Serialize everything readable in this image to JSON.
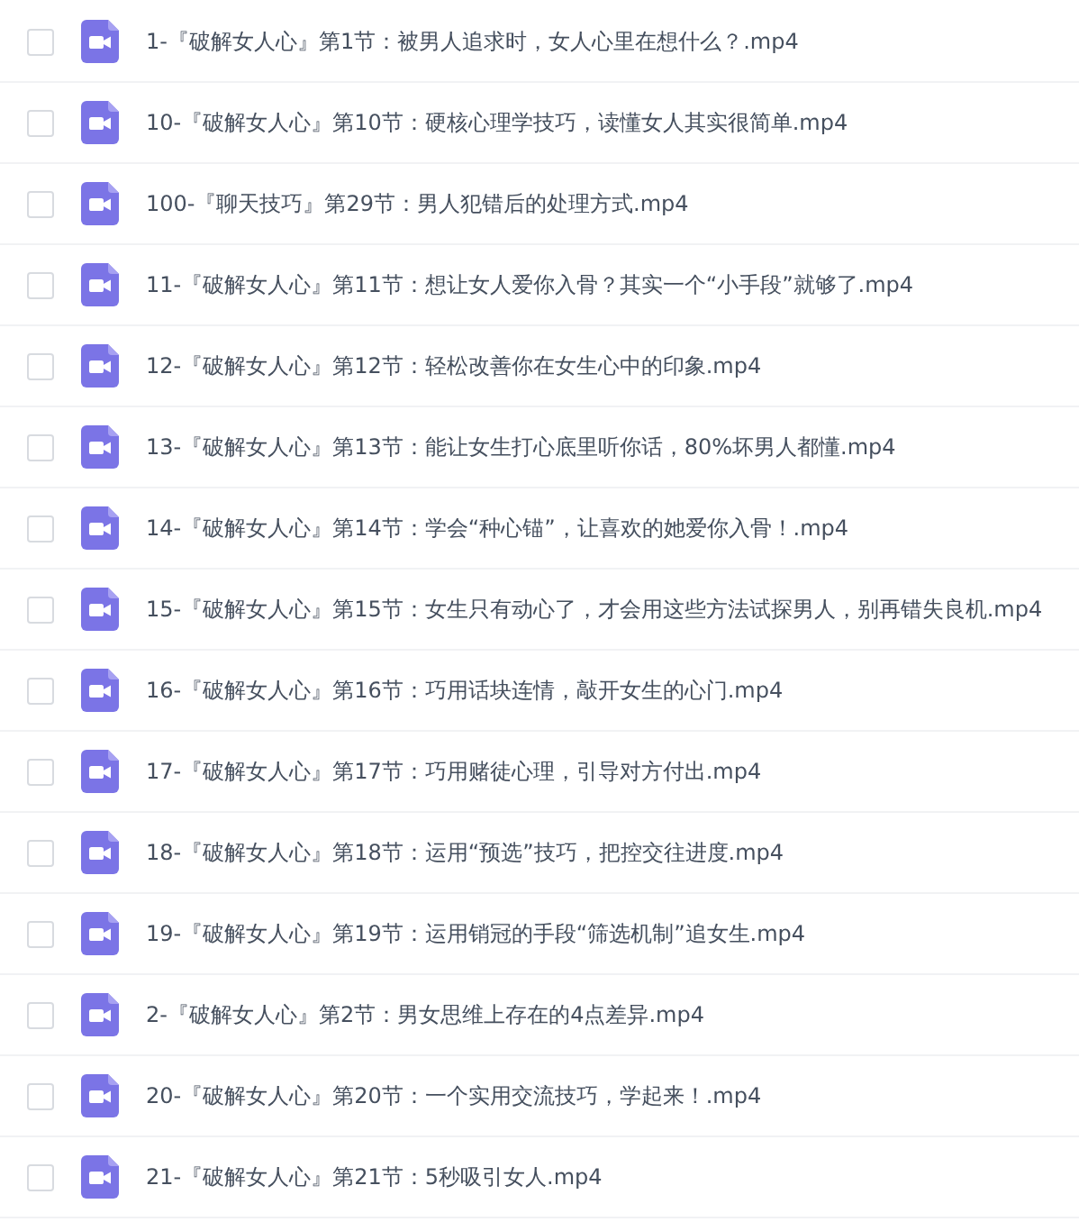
{
  "files": [
    {
      "name": "1-『破解女人心』第1节：被男人追求时，女人心里在想什么？.mp4",
      "checked": false
    },
    {
      "name": "10-『破解女人心』第10节：硬核心理学技巧，读懂女人其实很简单.mp4",
      "checked": false
    },
    {
      "name": "100-『聊天技巧』第29节：男人犯错后的处理方式.mp4",
      "checked": false
    },
    {
      "name": "11-『破解女人心』第11节：想让女人爱你入骨？其实一个“小手段”就够了.mp4",
      "checked": false
    },
    {
      "name": "12-『破解女人心』第12节：轻松改善你在女生心中的印象.mp4",
      "checked": false
    },
    {
      "name": "13-『破解女人心』第13节：能让女生打心底里听你话，80%坏男人都懂.mp4",
      "checked": false
    },
    {
      "name": "14-『破解女人心』第14节：学会“种心锚”，让喜欢的她爱你入骨！.mp4",
      "checked": false
    },
    {
      "name": "15-『破解女人心』第15节：女生只有动心了，才会用这些方法试探男人，别再错失良机.mp4",
      "checked": false
    },
    {
      "name": "16-『破解女人心』第16节：巧用话块连情，敲开女生的心门.mp4",
      "checked": false
    },
    {
      "name": "17-『破解女人心』第17节：巧用赌徒心理，引导对方付出.mp4",
      "checked": false
    },
    {
      "name": "18-『破解女人心』第18节：运用“预选”技巧，把控交往进度.mp4",
      "checked": false
    },
    {
      "name": "19-『破解女人心』第19节：运用销冠的手段“筛选机制”追女生.mp4",
      "checked": false
    },
    {
      "name": "2-『破解女人心』第2节：男女思维上存在的4点差异.mp4",
      "checked": false
    },
    {
      "name": "20-『破解女人心』第20节：一个实用交流技巧，学起来！.mp4",
      "checked": false
    },
    {
      "name": "21-『破解女人心』第21节：5秒吸引女人.mp4",
      "checked": false
    }
  ]
}
